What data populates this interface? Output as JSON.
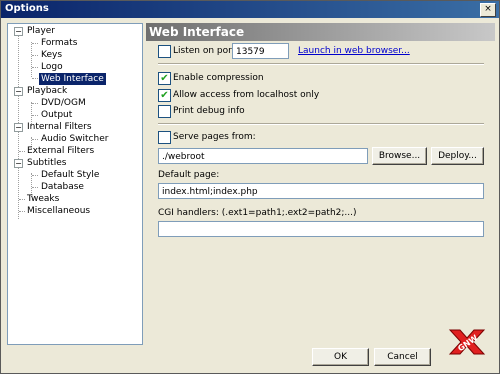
{
  "window": {
    "title": "Options",
    "close_glyph": "×"
  },
  "tree": {
    "items": [
      {
        "label": "Player"
      },
      {
        "label": "Formats"
      },
      {
        "label": "Keys"
      },
      {
        "label": "Logo"
      },
      {
        "label": "Web Interface"
      },
      {
        "label": "Playback"
      },
      {
        "label": "DVD/OGM"
      },
      {
        "label": "Output"
      },
      {
        "label": "Internal Filters"
      },
      {
        "label": "Audio Switcher"
      },
      {
        "label": "External Filters"
      },
      {
        "label": "Subtitles"
      },
      {
        "label": "Default Style"
      },
      {
        "label": "Database"
      },
      {
        "label": "Tweaks"
      },
      {
        "label": "Miscellaneous"
      }
    ],
    "expander_glyph": "−",
    "selected": "Web Interface"
  },
  "panel": {
    "title": "Web Interface",
    "listen": {
      "label": "Listen on port:",
      "checked": false,
      "port": "13579"
    },
    "launch_link": "Launch in web browser...",
    "enable_compression": {
      "label": "Enable compression",
      "checked": true,
      "mark": "✔"
    },
    "allow_localhost": {
      "label": "Allow access from localhost only",
      "checked": true,
      "mark": "✔"
    },
    "print_debug": {
      "label": "Print debug info",
      "checked": false
    },
    "serve_pages": {
      "label": "Serve pages from:",
      "checked": false,
      "path": "./webroot"
    },
    "browse_button": "Browse...",
    "deploy_button": "Deploy...",
    "default_page": {
      "label": "Default page:",
      "value": "index.html;index.php"
    },
    "cgi": {
      "label": "CGI handlers: (.ext1=path1;.ext2=path2;...)",
      "value": ""
    }
  },
  "footer": {
    "ok": "OK",
    "cancel": "Cancel"
  },
  "watermark": {
    "text": "GNW",
    "icon": "x-logo"
  },
  "colors": {
    "selection": "#0a246a",
    "check": "#21a121",
    "link": "#0000cc"
  }
}
